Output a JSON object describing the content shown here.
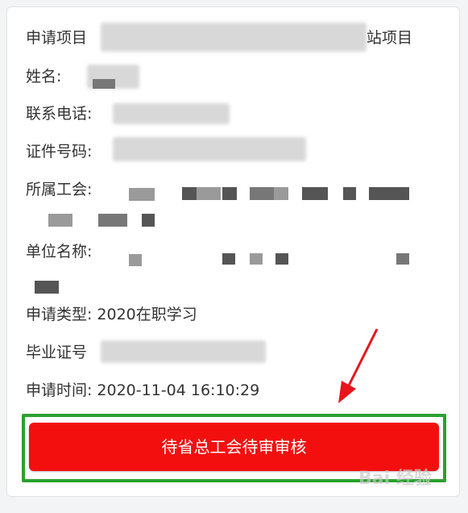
{
  "fields": {
    "project_label": "申请项目",
    "project_suffix": "站项目",
    "name_label": "姓名:",
    "phone_label": "联系电话:",
    "id_label": "证件号码:",
    "union_label": "所属工会:",
    "unit_label": "单位名称:",
    "type_label": "申请类型:",
    "type_value": "2020在职学习",
    "cert_label": "毕业证号",
    "time_label": "申请时间:",
    "time_value": "2020-11-04 16:10:29"
  },
  "status": {
    "button_label": "待省总工会待审审核"
  },
  "colors": {
    "button": "#f40f0f",
    "highlight_border": "#2aa12e",
    "arrow": "#e8141b"
  },
  "watermark": {
    "text": "Bai 经验"
  }
}
